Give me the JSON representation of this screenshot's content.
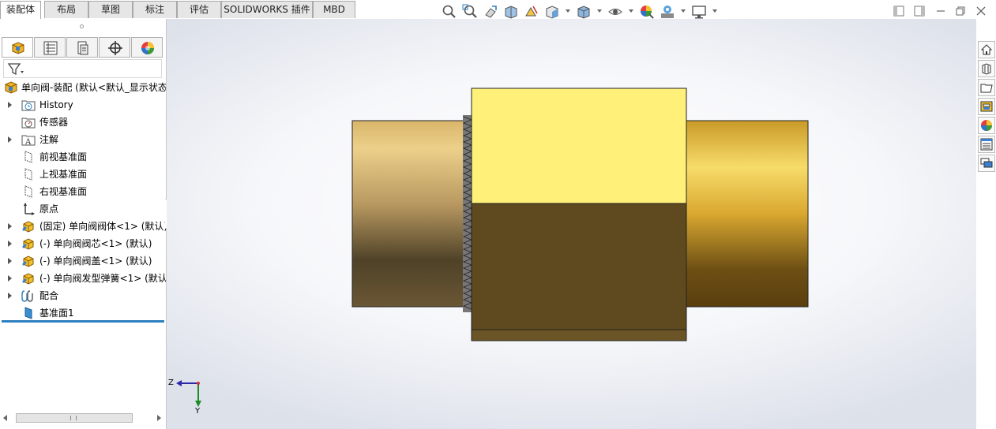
{
  "tabs": [
    {
      "label": "装配体",
      "active": true
    },
    {
      "label": "布局",
      "active": false
    },
    {
      "label": "草图",
      "active": false
    },
    {
      "label": "标注",
      "active": false
    },
    {
      "label": "评估",
      "active": false
    },
    {
      "label": "SOLIDWORKS 插件",
      "active": false
    },
    {
      "label": "MBD",
      "active": false
    }
  ],
  "heads_up_toolbar": [
    "zoom-to-fit-icon",
    "zoom-to-area-icon",
    "previous-view-icon",
    "section-view-icon",
    "dynamic-annotation-icon",
    "view-orientation-icon",
    "display-style-icon",
    "hide-show-items-icon",
    "edit-appearance-icon",
    "apply-scene-icon",
    "view-settings-icon"
  ],
  "feature_tree": {
    "root": "单向阀-装配  (默认<默认_显示状态",
    "items": [
      {
        "label": "History",
        "expandable": true,
        "icon": "history-folder-icon"
      },
      {
        "label": "传感器",
        "expandable": false,
        "icon": "sensor-icon"
      },
      {
        "label": "注解",
        "expandable": true,
        "icon": "annotation-icon"
      },
      {
        "label": "前视基准面",
        "expandable": false,
        "icon": "plane-icon"
      },
      {
        "label": "上视基准面",
        "expandable": false,
        "icon": "plane-icon"
      },
      {
        "label": "右视基准面",
        "expandable": false,
        "icon": "plane-icon"
      },
      {
        "label": "原点",
        "expandable": false,
        "icon": "origin-icon"
      },
      {
        "label": "(固定) 单向阀阀体<1> (默认)",
        "expandable": true,
        "icon": "part-icon"
      },
      {
        "label": "(-) 单向阀阀芯<1> (默认)",
        "expandable": true,
        "icon": "part-icon"
      },
      {
        "label": "(-) 单向阀阀盖<1> (默认)",
        "expandable": true,
        "icon": "part-icon"
      },
      {
        "label": "(-) 单向阀发型弹簧<1> (默认",
        "expandable": true,
        "icon": "part-icon"
      },
      {
        "label": "配合",
        "expandable": true,
        "icon": "mates-icon"
      },
      {
        "label": "基准面1",
        "expandable": false,
        "icon": "plane-filled-icon"
      }
    ]
  },
  "triad": {
    "axis_1": "Z",
    "axis_2": "Y"
  },
  "colors": {
    "accent_blue": "#2e7fbf",
    "body_gold": "#c8a040",
    "cap_yellow": "#fff07a",
    "cap_dark": "#5e4a1e"
  }
}
